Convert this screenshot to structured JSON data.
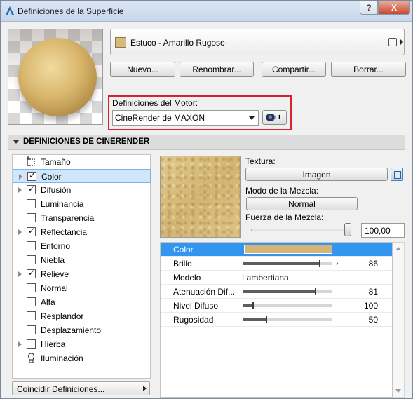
{
  "window": {
    "title": "Definiciones de la Superficie",
    "help_label": "?",
    "close_label": "X"
  },
  "material": {
    "name": "Estuco - Amarillo Rugoso",
    "swatch_color": "#d4ba7c"
  },
  "buttons": {
    "new": "Nuevo...",
    "rename": "Renombrar...",
    "share": "Compartir...",
    "delete": "Borrar..."
  },
  "engine": {
    "label": "Definiciones del Motor:",
    "selected": "CineRender de MAXON",
    "info_label": "i"
  },
  "section": {
    "title": "DEFINICIONES DE CINERENDER"
  },
  "channels": [
    {
      "label": "Tamaño",
      "icon": "size-icon",
      "expandable": false,
      "checked": null,
      "selected": false
    },
    {
      "label": "Color",
      "expandable": true,
      "checked": true,
      "selected": true
    },
    {
      "label": "Difusión",
      "expandable": true,
      "checked": true,
      "selected": false
    },
    {
      "label": "Luminancia",
      "expandable": false,
      "checked": false,
      "selected": false
    },
    {
      "label": "Transparencia",
      "expandable": false,
      "checked": false,
      "selected": false
    },
    {
      "label": "Reflectancia",
      "expandable": true,
      "checked": true,
      "selected": false
    },
    {
      "label": "Entorno",
      "expandable": false,
      "checked": false,
      "selected": false
    },
    {
      "label": "Niebla",
      "expandable": false,
      "checked": false,
      "selected": false
    },
    {
      "label": "Relieve",
      "expandable": true,
      "checked": true,
      "selected": false
    },
    {
      "label": "Normal",
      "expandable": false,
      "checked": false,
      "selected": false
    },
    {
      "label": "Alfa",
      "expandable": false,
      "checked": false,
      "selected": false
    },
    {
      "label": "Resplandor",
      "expandable": false,
      "checked": false,
      "selected": false
    },
    {
      "label": "Desplazamiento",
      "expandable": false,
      "checked": false,
      "selected": false
    },
    {
      "label": "Hierba",
      "expandable": true,
      "checked": false,
      "selected": false
    },
    {
      "label": "Iluminación",
      "icon": "lighting-icon",
      "expandable": false,
      "checked": null,
      "selected": false
    }
  ],
  "match_button": "Coincidir Definiciones...",
  "texture": {
    "label": "Textura:",
    "button": "Imagen"
  },
  "mix": {
    "mode_label": "Modo de la Mezcla:",
    "mode_value": "Normal",
    "strength_label": "Fuerza de la Mezcla:",
    "strength_value": "100,00",
    "strength_fraction": 1.0
  },
  "properties": [
    {
      "name": "Color",
      "type": "color",
      "color": "#d4b577",
      "selected": true
    },
    {
      "name": "Brillo",
      "type": "slider",
      "value": "86",
      "fraction": 0.86,
      "chevron": true
    },
    {
      "name": "Modelo",
      "type": "text",
      "text": "Lambertiana"
    },
    {
      "name": "Atenuación Dif...",
      "type": "slider",
      "value": "81",
      "fraction": 0.81
    },
    {
      "name": "Nivel Difuso",
      "type": "slider",
      "value": "100",
      "fraction": 0.1
    },
    {
      "name": "Rugosidad",
      "type": "slider",
      "value": "50",
      "fraction": 0.25
    }
  ]
}
